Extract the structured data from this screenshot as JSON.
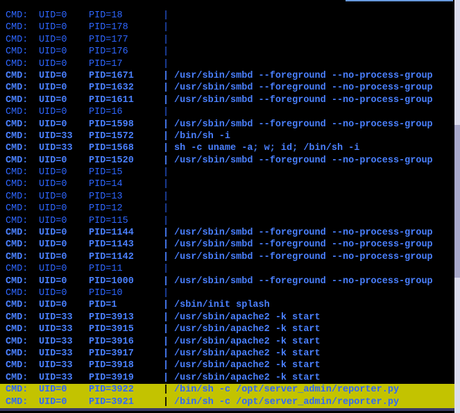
{
  "columns": {
    "cmd_label": "CMD:",
    "uid_prefix": "UID=",
    "pid_prefix": "PID=",
    "bar": "|"
  },
  "rows": [
    {
      "uid": "0",
      "pid": "18",
      "arg": "",
      "bold": false
    },
    {
      "uid": "0",
      "pid": "178",
      "arg": "",
      "bold": false
    },
    {
      "uid": "0",
      "pid": "177",
      "arg": "",
      "bold": false
    },
    {
      "uid": "0",
      "pid": "176",
      "arg": "",
      "bold": false
    },
    {
      "uid": "0",
      "pid": "17",
      "arg": "",
      "bold": false
    },
    {
      "uid": "0",
      "pid": "1671",
      "arg": "/usr/sbin/smbd --foreground --no-process-group",
      "bold": true
    },
    {
      "uid": "0",
      "pid": "1632",
      "arg": "/usr/sbin/smbd --foreground --no-process-group",
      "bold": true
    },
    {
      "uid": "0",
      "pid": "1611",
      "arg": "/usr/sbin/smbd --foreground --no-process-group",
      "bold": true
    },
    {
      "uid": "0",
      "pid": "16",
      "arg": "",
      "bold": false
    },
    {
      "uid": "0",
      "pid": "1598",
      "arg": "/usr/sbin/smbd --foreground --no-process-group",
      "bold": true
    },
    {
      "uid": "33",
      "pid": "1572",
      "arg": "/bin/sh -i",
      "bold": true
    },
    {
      "uid": "33",
      "pid": "1568",
      "arg": "sh -c uname -a; w; id; /bin/sh -i",
      "bold": true
    },
    {
      "uid": "0",
      "pid": "1520",
      "arg": "/usr/sbin/smbd --foreground --no-process-group",
      "bold": true
    },
    {
      "uid": "0",
      "pid": "15",
      "arg": "",
      "bold": false
    },
    {
      "uid": "0",
      "pid": "14",
      "arg": "",
      "bold": false
    },
    {
      "uid": "0",
      "pid": "13",
      "arg": "",
      "bold": false
    },
    {
      "uid": "0",
      "pid": "12",
      "arg": "",
      "bold": false
    },
    {
      "uid": "0",
      "pid": "115",
      "arg": "",
      "bold": false
    },
    {
      "uid": "0",
      "pid": "1144",
      "arg": "/usr/sbin/smbd --foreground --no-process-group",
      "bold": true
    },
    {
      "uid": "0",
      "pid": "1143",
      "arg": "/usr/sbin/smbd --foreground --no-process-group",
      "bold": true
    },
    {
      "uid": "0",
      "pid": "1142",
      "arg": "/usr/sbin/smbd --foreground --no-process-group",
      "bold": true
    },
    {
      "uid": "0",
      "pid": "11",
      "arg": "",
      "bold": false
    },
    {
      "uid": "0",
      "pid": "1000",
      "arg": "/usr/sbin/smbd --foreground --no-process-group",
      "bold": true
    },
    {
      "uid": "0",
      "pid": "10",
      "arg": "",
      "bold": false
    },
    {
      "uid": "0",
      "pid": "1",
      "arg": "/sbin/init splash",
      "bold": true
    },
    {
      "uid": "33",
      "pid": "3913",
      "arg": "/usr/sbin/apache2 -k start",
      "bold": true
    },
    {
      "uid": "33",
      "pid": "3915",
      "arg": "/usr/sbin/apache2 -k start",
      "bold": true
    },
    {
      "uid": "33",
      "pid": "3916",
      "arg": "/usr/sbin/apache2 -k start",
      "bold": true
    },
    {
      "uid": "33",
      "pid": "3917",
      "arg": "/usr/sbin/apache2 -k start",
      "bold": true
    },
    {
      "uid": "33",
      "pid": "3918",
      "arg": "/usr/sbin/apache2 -k start",
      "bold": true
    },
    {
      "uid": "33",
      "pid": "3919",
      "arg": "/usr/sbin/apache2 -k start",
      "bold": true
    },
    {
      "uid": "0",
      "pid": "3922",
      "arg": "/bin/sh -c /opt/server_admin/reporter.py",
      "bold": true,
      "hl": true
    },
    {
      "uid": "0",
      "pid": "3921",
      "arg": "/bin/sh -c /opt/server_admin/reporter.py",
      "bold": true,
      "hl": true
    }
  ]
}
